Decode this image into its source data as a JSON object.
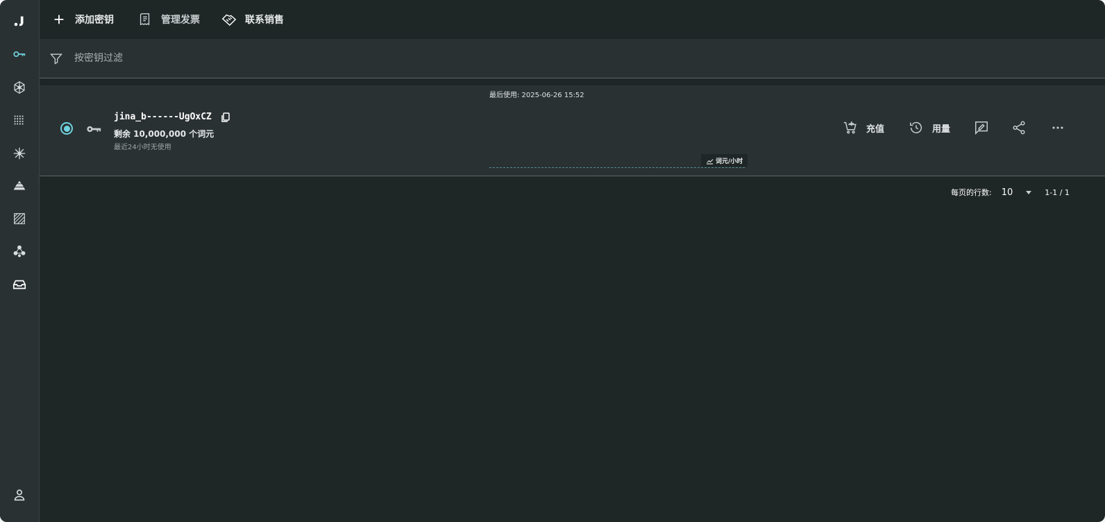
{
  "sidebar": {
    "items": [
      {
        "name": "jina-logo-icon"
      },
      {
        "name": "key-icon"
      },
      {
        "name": "network-icon"
      },
      {
        "name": "grid-icon"
      },
      {
        "name": "snowflake-icon"
      },
      {
        "name": "layers-icon"
      },
      {
        "name": "pattern-icon"
      },
      {
        "name": "molecule-icon"
      },
      {
        "name": "inbox-icon"
      }
    ],
    "active_color": "#6fd3df"
  },
  "toolbar": {
    "add_key": "添加密钥",
    "manage_invoices": "管理发票",
    "contact_sales": "联系销售"
  },
  "filter": {
    "placeholder": "按密钥过滤",
    "value": ""
  },
  "key": {
    "last_used": "最后使用: 2025-06-26 15:52",
    "name": "jina_b------UgOxCZ",
    "remaining": "剩余 10,000,000 个词元",
    "idle_note": "最近24小时无使用",
    "chart_unit": "词元/小时",
    "selected": true,
    "actions": {
      "topup": "充值",
      "usage": "用量"
    }
  },
  "pagination": {
    "rows_per_page_label": "每页的行数:",
    "rows_per_page": "10",
    "range": "1-1 / 1"
  },
  "colors": {
    "accent": "#6fd3df",
    "background": "#1f2626",
    "panel": "#2a3132"
  }
}
